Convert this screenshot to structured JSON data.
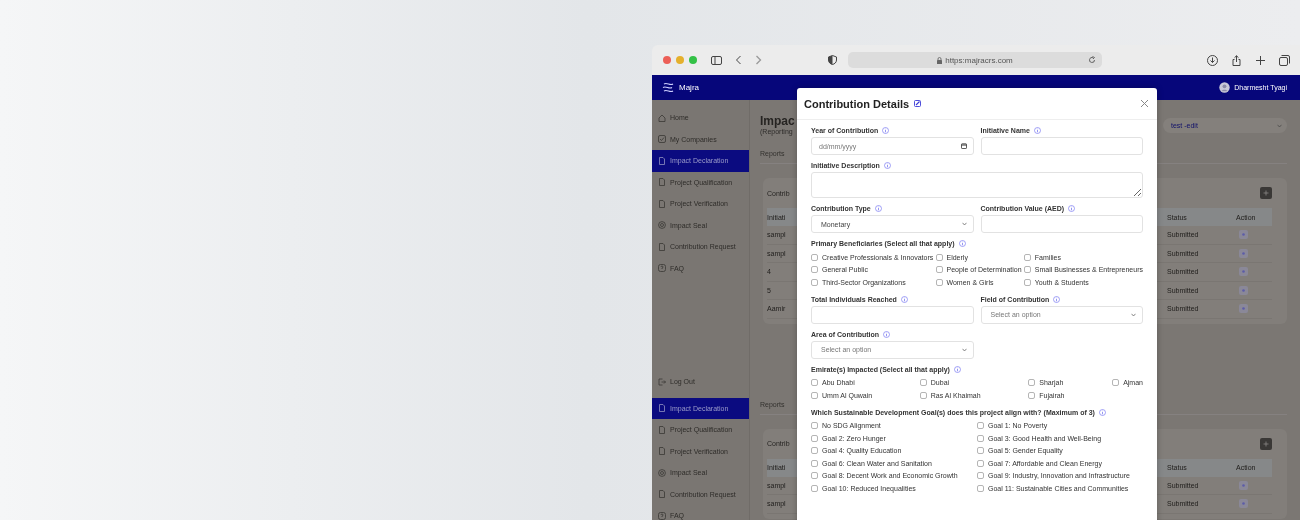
{
  "browser": {
    "url": "https:majracrs.com"
  },
  "app_header": {
    "brand": "Majra",
    "user": "Dharmesht Tyagi"
  },
  "sidebar": {
    "items": [
      {
        "label": "Home",
        "selected": false
      },
      {
        "label": "My Companies",
        "selected": false
      },
      {
        "label": "Impact Declaration",
        "selected": true
      },
      {
        "label": "Project Qualification",
        "selected": false
      },
      {
        "label": "Project Verification",
        "selected": false
      },
      {
        "label": "Impact Seal",
        "selected": false
      },
      {
        "label": "Contribution Request",
        "selected": false
      },
      {
        "label": "FAQ",
        "selected": false
      }
    ],
    "logout": "Log Out"
  },
  "lower_sidebar": {
    "items": [
      {
        "label": "Impact Declaration",
        "selected": true
      },
      {
        "label": "Project Qualification",
        "selected": false
      },
      {
        "label": "Project Verification",
        "selected": false
      },
      {
        "label": "Impact Seal",
        "selected": false
      },
      {
        "label": "Contribution Request",
        "selected": false
      },
      {
        "label": "FAQ",
        "selected": false
      }
    ]
  },
  "main": {
    "title": "Impac",
    "subtitle": "(Reporting",
    "dropdown": "test -edit",
    "sections": [
      {
        "tab": "Reports",
        "card": {
          "title": "Contrib",
          "columns": [
            "Initiati",
            "Status",
            "Action"
          ],
          "rows": [
            {
              "cells": [
                "sampl",
                "Submitted"
              ]
            },
            {
              "cells": [
                "sampl",
                "Submitted"
              ]
            },
            {
              "cells": [
                "4",
                "Submitted"
              ]
            },
            {
              "cells": [
                "5",
                "Submitted"
              ]
            },
            {
              "cells": [
                "Aamir",
                "Submitted"
              ]
            }
          ]
        }
      },
      {
        "tab": "Reports",
        "card": {
          "title": "Contrib",
          "columns": [
            "Initiati",
            "Status",
            "Action"
          ],
          "rows": [
            {
              "cells": [
                "sampl",
                "Submitted"
              ]
            },
            {
              "cells": [
                "sampl",
                "Submitted"
              ]
            }
          ]
        }
      }
    ]
  },
  "modal": {
    "title": "Contribution Details",
    "fields": [
      {
        "kind": "date",
        "label": "Year of Contribution",
        "placeholder": "dd/mm/yyyy"
      },
      {
        "kind": "text",
        "label": "Initiative Name"
      },
      {
        "kind": "textarea",
        "label": "Initiative Description"
      },
      {
        "kind": "select",
        "label": "Contribution Type",
        "value": "Monetary"
      },
      {
        "kind": "text",
        "label": "Contribution Value (AED)"
      },
      {
        "kind": "checkboxes",
        "label": "Primary Beneficiaries (Select all that apply)",
        "options": [
          {
            "label": "Creative Professionals & Innovators",
            "checked": false
          },
          {
            "label": "Elderly",
            "checked": false
          },
          {
            "label": "Families",
            "checked": false
          },
          {
            "label": "General Public",
            "checked": false
          },
          {
            "label": "People of Determination",
            "checked": false
          },
          {
            "label": "Small Businesses & Entrepreneurs",
            "checked": false
          },
          {
            "label": "Third-Sector Organizations",
            "checked": false
          },
          {
            "label": "Women & Girls",
            "checked": false
          },
          {
            "label": "Youth & Students",
            "checked": false
          }
        ]
      },
      {
        "kind": "text",
        "label": "Total Individuals Reached"
      },
      {
        "kind": "select",
        "label": "Field of Contribution",
        "placeholder": "Select an option"
      },
      {
        "kind": "select",
        "label": "Area of Contribution",
        "placeholder": "Select an option"
      },
      {
        "kind": "checkboxes",
        "label": "Emirate(s) Impacted (Select all that apply)",
        "options": [
          {
            "label": "Abu Dhabi",
            "checked": false
          },
          {
            "label": "Dubai",
            "checked": false
          },
          {
            "label": "Sharjah",
            "checked": false
          },
          {
            "label": "Ajman",
            "checked": false
          },
          {
            "label": "Umm Al Quwain",
            "checked": false
          },
          {
            "label": "Ras Al Khaimah",
            "checked": false
          },
          {
            "label": "Fujairah",
            "checked": false
          }
        ]
      },
      {
        "kind": "checkboxes",
        "label": "Which Sustainable Development Goal(s) does this project align with? (Maximum of 3)",
        "options": [
          {
            "label": "No SDG Alignment",
            "checked": false
          },
          {
            "label": "Goal 1: No Poverty",
            "checked": false
          },
          {
            "label": "Goal 2: Zero Hunger",
            "checked": false
          },
          {
            "label": "Goal 3: Good Health and Well-Being",
            "checked": false
          },
          {
            "label": "Goal 4: Quality Education",
            "checked": false
          },
          {
            "label": "Goal 5: Gender Equality",
            "checked": false
          },
          {
            "label": "Goal 6: Clean Water and Sanitation",
            "checked": false
          },
          {
            "label": "Goal 7: Affordable and Clean Energy",
            "checked": false
          },
          {
            "label": "Goal 8: Decent Work and Economic Growth",
            "checked": false
          },
          {
            "label": "Goal 9: Industry, Innovation and Infrastructure",
            "checked": false
          },
          {
            "label": "Goal 10: Reduced Inequalities",
            "checked": false
          },
          {
            "label": "Goal 11: Sustainable Cities and Communities",
            "checked": false
          }
        ]
      }
    ]
  }
}
